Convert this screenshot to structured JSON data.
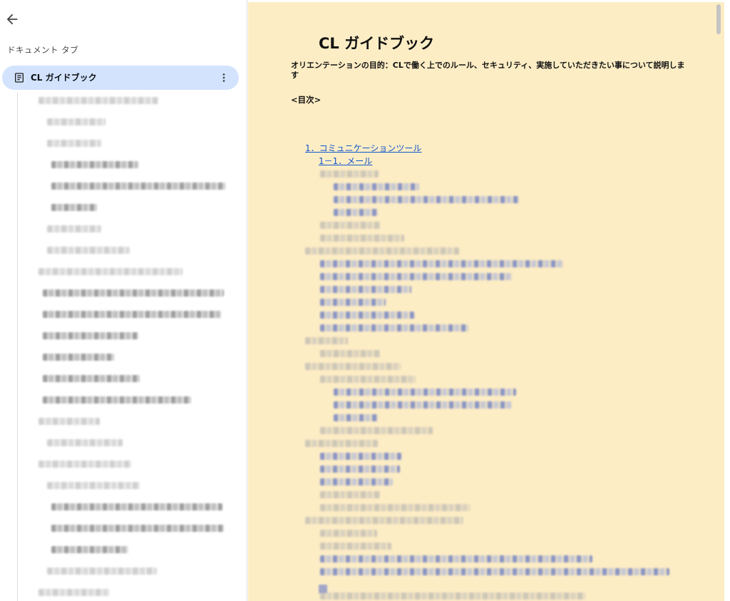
{
  "sidebar": {
    "heading": "ドキュメント タブ",
    "active_tab": {
      "label": "CL ガイドブック"
    },
    "icons": {
      "back": "arrow-back-icon",
      "doc": "document-icon",
      "more": "more-vert-icon"
    }
  },
  "document": {
    "title": "CL ガイドブック",
    "purpose": "オリエンテーションの目的：CLで働く上でのルール、セキュリティ、実施していただきたい事について説明します",
    "toc_heading": "<目次>",
    "toc_links": [
      "1．コミュニケーションツール",
      "1－1．メール"
    ]
  },
  "colors": {
    "doc_background": "#fdedc5",
    "active_tab": "#d3e3fd",
    "link": "#1155cc"
  }
}
